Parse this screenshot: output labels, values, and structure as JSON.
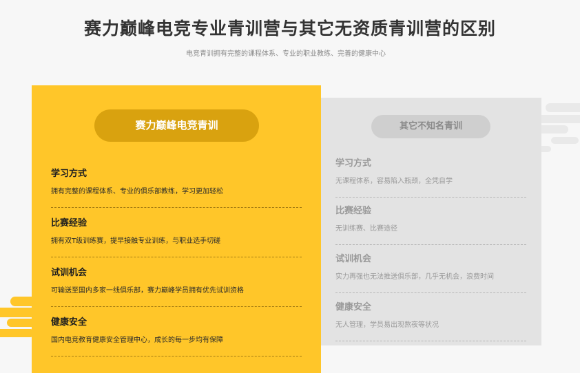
{
  "header": {
    "title": "赛力巅峰电竞专业青训营与其它无资质青训营的区别",
    "subtitle": "电竞青训拥有完整的课程体系、专业的职业教练、完善的健康中心"
  },
  "ours": {
    "label": "赛力巅峰电竞青训",
    "items": [
      {
        "title": "学习方式",
        "desc": "拥有完整的课程体系、专业的俱乐部教练，学习更加轻松"
      },
      {
        "title": "比赛经验",
        "desc": "拥有双T级训练赛，提早接触专业训练，与职业选手切磋"
      },
      {
        "title": "试训机会",
        "desc": "可输送至国内多家一线俱乐部，赛力巅峰学员拥有优先试训资格"
      },
      {
        "title": "健康安全",
        "desc": "国内电竞教育健康安全管理中心，成长的每一步均有保障"
      }
    ]
  },
  "others": {
    "label": "其它不知名青训",
    "items": [
      {
        "title": "学习方式",
        "desc": "无课程体系，容易陷入瓶颈，全凭自学"
      },
      {
        "title": "比赛经验",
        "desc": "无训练赛、比赛途径"
      },
      {
        "title": "试训机会",
        "desc": "实力再强也无法推送俱乐部，几乎无机会，浪费时间"
      },
      {
        "title": "健康安全",
        "desc": "无人管理，学员易出现熬夜等状况"
      }
    ]
  },
  "colors": {
    "accent": "#ffc629",
    "accent_dark": "#d9a20f",
    "panel_gray": "#e3e3e3"
  }
}
